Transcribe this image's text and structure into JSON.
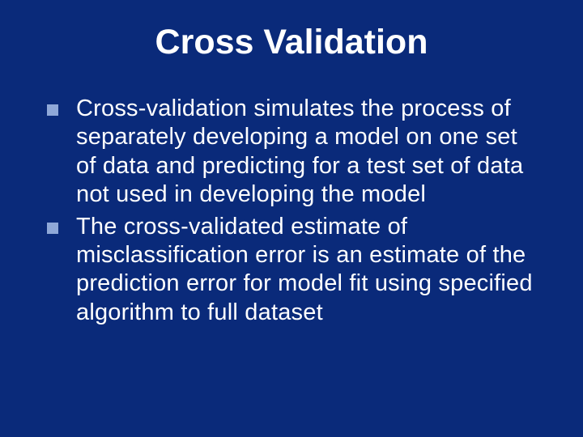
{
  "slide": {
    "title": "Cross Validation",
    "bullets": [
      "Cross-validation simulates the process of separately developing a model on one set of data and predicting for a test set of data not used in developing the model",
      "The cross-validated estimate of misclassification error is an estimate of the prediction error for model fit using specified algorithm to full dataset"
    ]
  }
}
